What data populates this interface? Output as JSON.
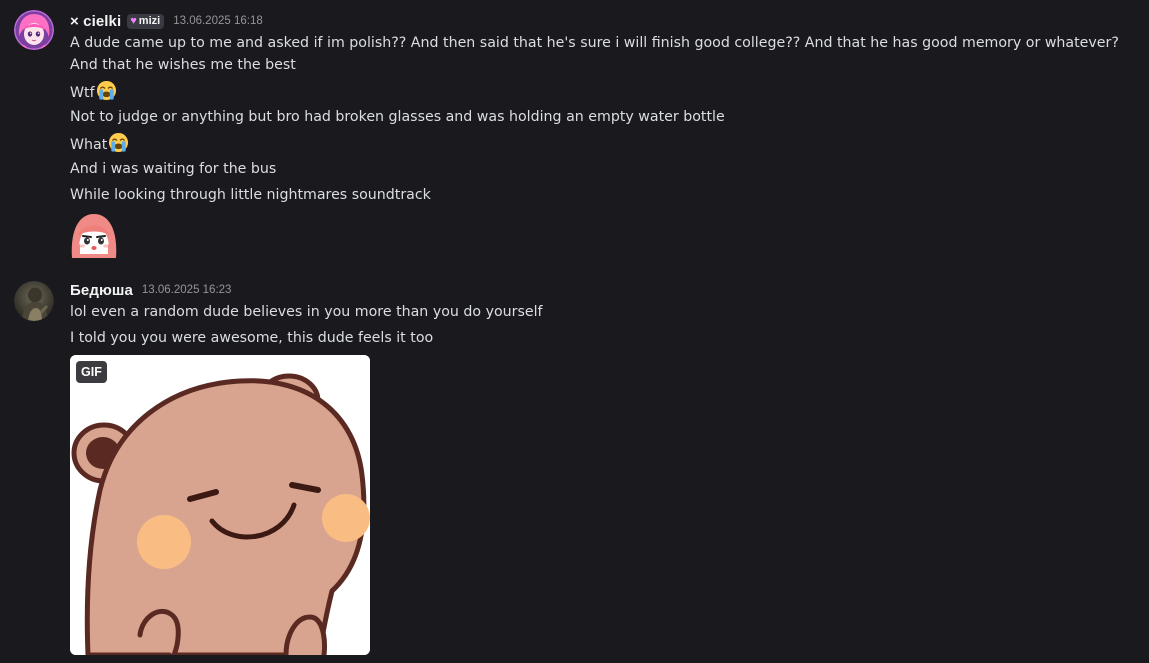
{
  "messages": [
    {
      "author": "× cielki",
      "tag": "mizi",
      "timestamp": "13.06.2025 16:18",
      "avatar": "anime-girl-avatar",
      "lines": [
        "A dude came up to me and asked if im polish?? And then said that he's sure i will finish good college?? And that he has good memory or whatever?  And that he wishes me the best",
        "Wtf",
        "Not to judge or anything but bro had broken glasses and was holding an empty water bottle",
        "What",
        "And i was waiting for the bus",
        "While looking through little nightmares soundtrack"
      ],
      "emojis": [
        "loudly-crying-face",
        "loudly-crying-face"
      ],
      "sticker": "pink-hair-anime-sticker"
    },
    {
      "author": "Бедюша",
      "timestamp": "13.06.2025 16:23",
      "avatar": "dark-photo-avatar",
      "lines": [
        "lol even a random dude believes in you more than you do yourself",
        "I told you you were awesome, this dude feels it too"
      ],
      "attachment": {
        "badge": "GIF",
        "content": "smiling-bear-gif"
      }
    }
  ],
  "colors": {
    "background": "#1a1a1e",
    "text": "#dbdee1",
    "username": "#f2f3f5",
    "timestamp": "#94959c",
    "tag_heart": "#f47fff"
  }
}
